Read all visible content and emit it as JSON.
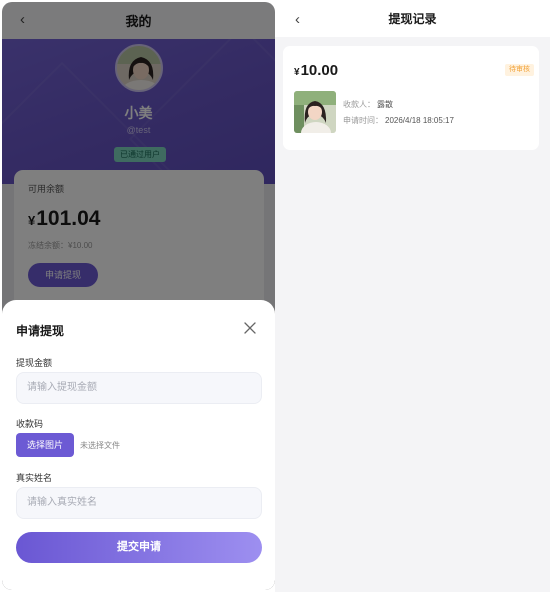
{
  "profile_page": {
    "nav": {
      "back_glyph": "‹",
      "title": "我的"
    },
    "user": {
      "name": "小美",
      "handle": "@test",
      "badge": "已通过用户"
    },
    "balance": {
      "label": "可用余额",
      "currency": "¥",
      "amount": "101.04",
      "frozen": "冻结余额：¥10.00",
      "apply_button": "申请提现"
    }
  },
  "withdraw_sheet": {
    "title": "申请提现",
    "close_icon": "close-icon",
    "amount_label": "提现金额",
    "amount_placeholder": "请输入提现金额",
    "qr_label": "收款码",
    "choose_image_button": "选择图片",
    "no_file_text": "未选择文件",
    "name_label": "真实姓名",
    "name_placeholder": "请输入真实姓名",
    "submit_button": "提交申请"
  },
  "records_page": {
    "nav": {
      "back_glyph": "‹",
      "title": "提现记录"
    },
    "records": [
      {
        "currency": "¥",
        "amount": "10.00",
        "status": "待审核",
        "status_color": "#f2a33a",
        "payee_label": "收款人：",
        "payee": "露散",
        "time_label": "申请时间：",
        "time": "2026/4/18 18:05:17"
      }
    ]
  },
  "colors": {
    "accent": "#6c5ad4",
    "hero_bg": "#6d5bd0",
    "overlay": "rgba(0,0,0,0.5)"
  }
}
